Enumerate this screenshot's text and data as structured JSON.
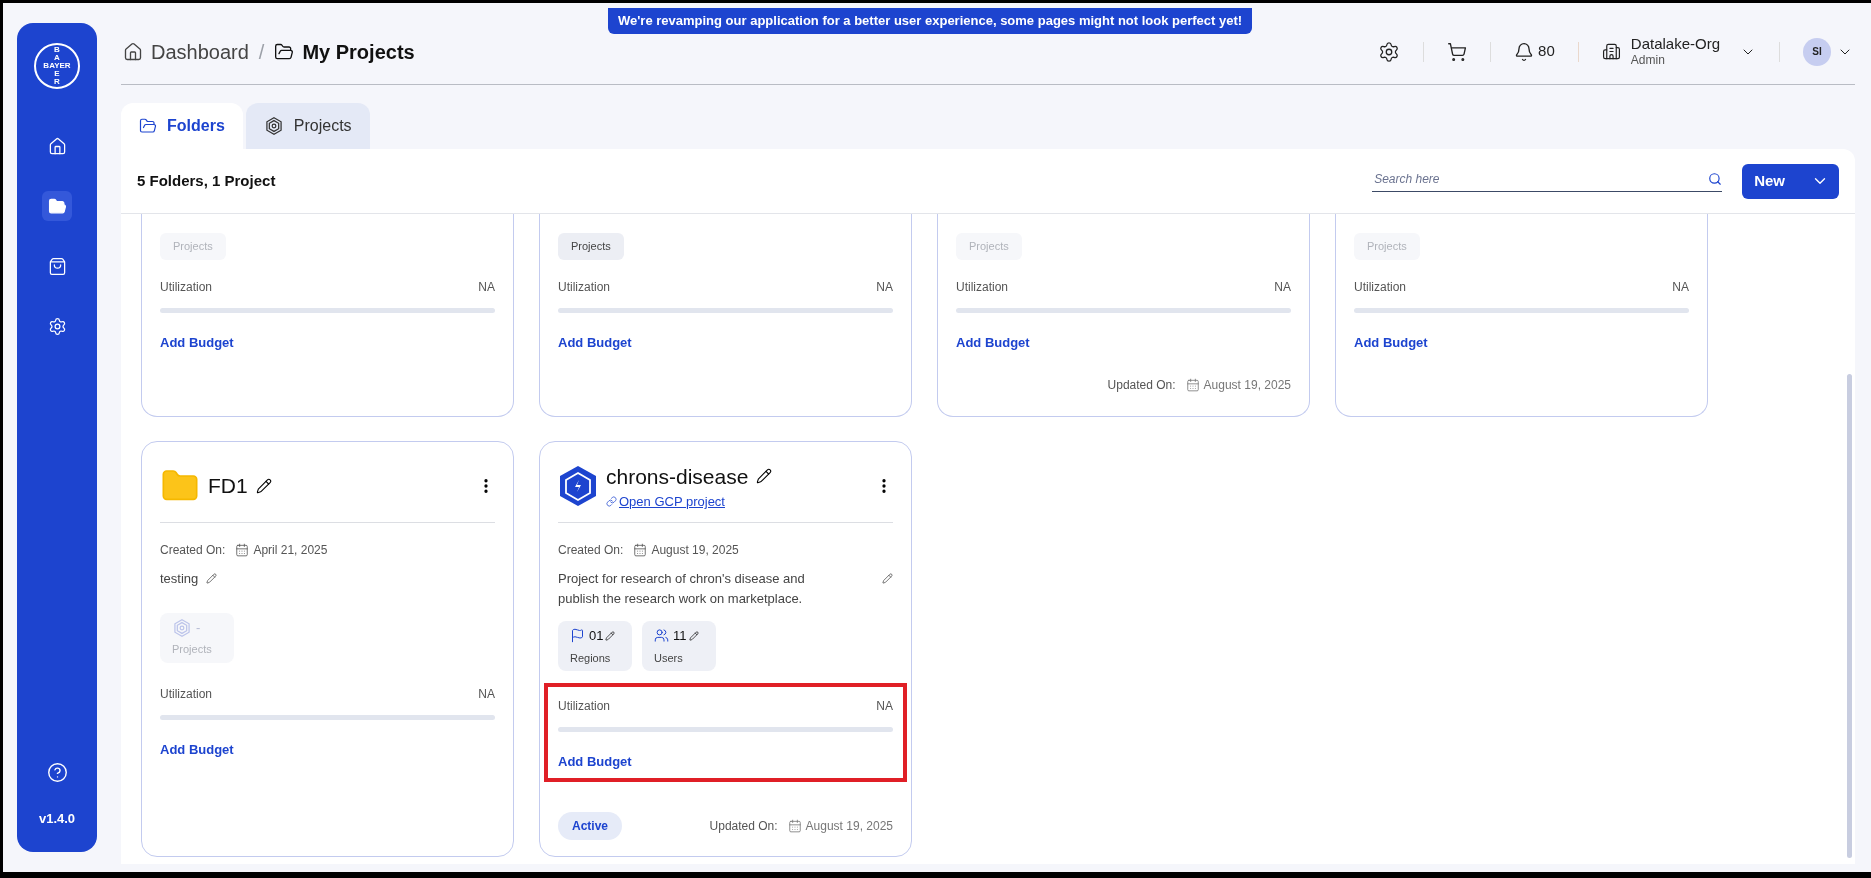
{
  "banner": "We're revamping our application for a better user experience, some pages might not look perfect yet!",
  "sidebar": {
    "items": [
      {
        "kind": "home",
        "selected": false
      },
      {
        "kind": "folders",
        "selected": true
      },
      {
        "kind": "bag",
        "selected": false
      },
      {
        "kind": "settings",
        "selected": false
      }
    ],
    "version": "v1.4.0"
  },
  "logo": {
    "top": "BA",
    "middle": "BAYER",
    "bottom": "ER"
  },
  "breadcrumb_separator": "/",
  "breadcrumb": [
    {
      "label": "Dashboard",
      "kind": "home"
    },
    {
      "label": "My Projects",
      "kind": "folder"
    }
  ],
  "header": {
    "notifications": "80",
    "org_name": "Datalake-Org",
    "org_role": "Admin",
    "avatar": "SI"
  },
  "tabs": [
    {
      "label": "Folders",
      "kind": "folder",
      "selected": true
    },
    {
      "label": "Projects",
      "kind": "project",
      "selected": false
    }
  ],
  "summary": "5 Folders, 1 Project",
  "search": {
    "placeholder": "Search here"
  },
  "new_button": "New",
  "top_cards": [
    {
      "projects_label": "Projects",
      "projects_enabled": false,
      "utilization_label": "Utilization",
      "utilization_value": "NA",
      "add_budget": "Add Budget"
    },
    {
      "projects_label": "Projects",
      "projects_enabled": true,
      "utilization_label": "Utilization",
      "utilization_value": "NA",
      "add_budget": "Add Budget"
    },
    {
      "projects_label": "Projects",
      "projects_enabled": false,
      "utilization_label": "Utilization",
      "utilization_value": "NA",
      "add_budget": "Add Budget",
      "updated_label": "Updated On:",
      "updated_date": "August 19, 2025"
    },
    {
      "projects_label": "Projects",
      "projects_enabled": false,
      "utilization_label": "Utilization",
      "utilization_value": "NA",
      "add_budget": "Add Budget"
    }
  ],
  "cards": [
    {
      "kind": "folder",
      "name": "FD1",
      "created_label": "Created On:",
      "created_date": "April 21, 2025",
      "description": "testing",
      "projects_count": "-",
      "projects_label": "Projects",
      "utilization_label": "Utilization",
      "utilization_value": "NA",
      "add_budget": "Add Budget",
      "highlighted": false
    },
    {
      "kind": "project",
      "name": "chrons-disease",
      "link": "Open GCP project",
      "created_label": "Created On:",
      "created_date": "August 19, 2025",
      "description": "Project for research of chron's disease and publish the research work on marketplace.",
      "stats": [
        {
          "kind": "regions",
          "value": "01",
          "label": "Regions"
        },
        {
          "kind": "users",
          "value": "11",
          "label": "Users"
        }
      ],
      "utilization_label": "Utilization",
      "utilization_value": "NA",
      "add_budget": "Add Budget",
      "highlighted": true,
      "status": "Active",
      "updated_label": "Updated On:",
      "updated_date": "August 19, 2025"
    }
  ]
}
